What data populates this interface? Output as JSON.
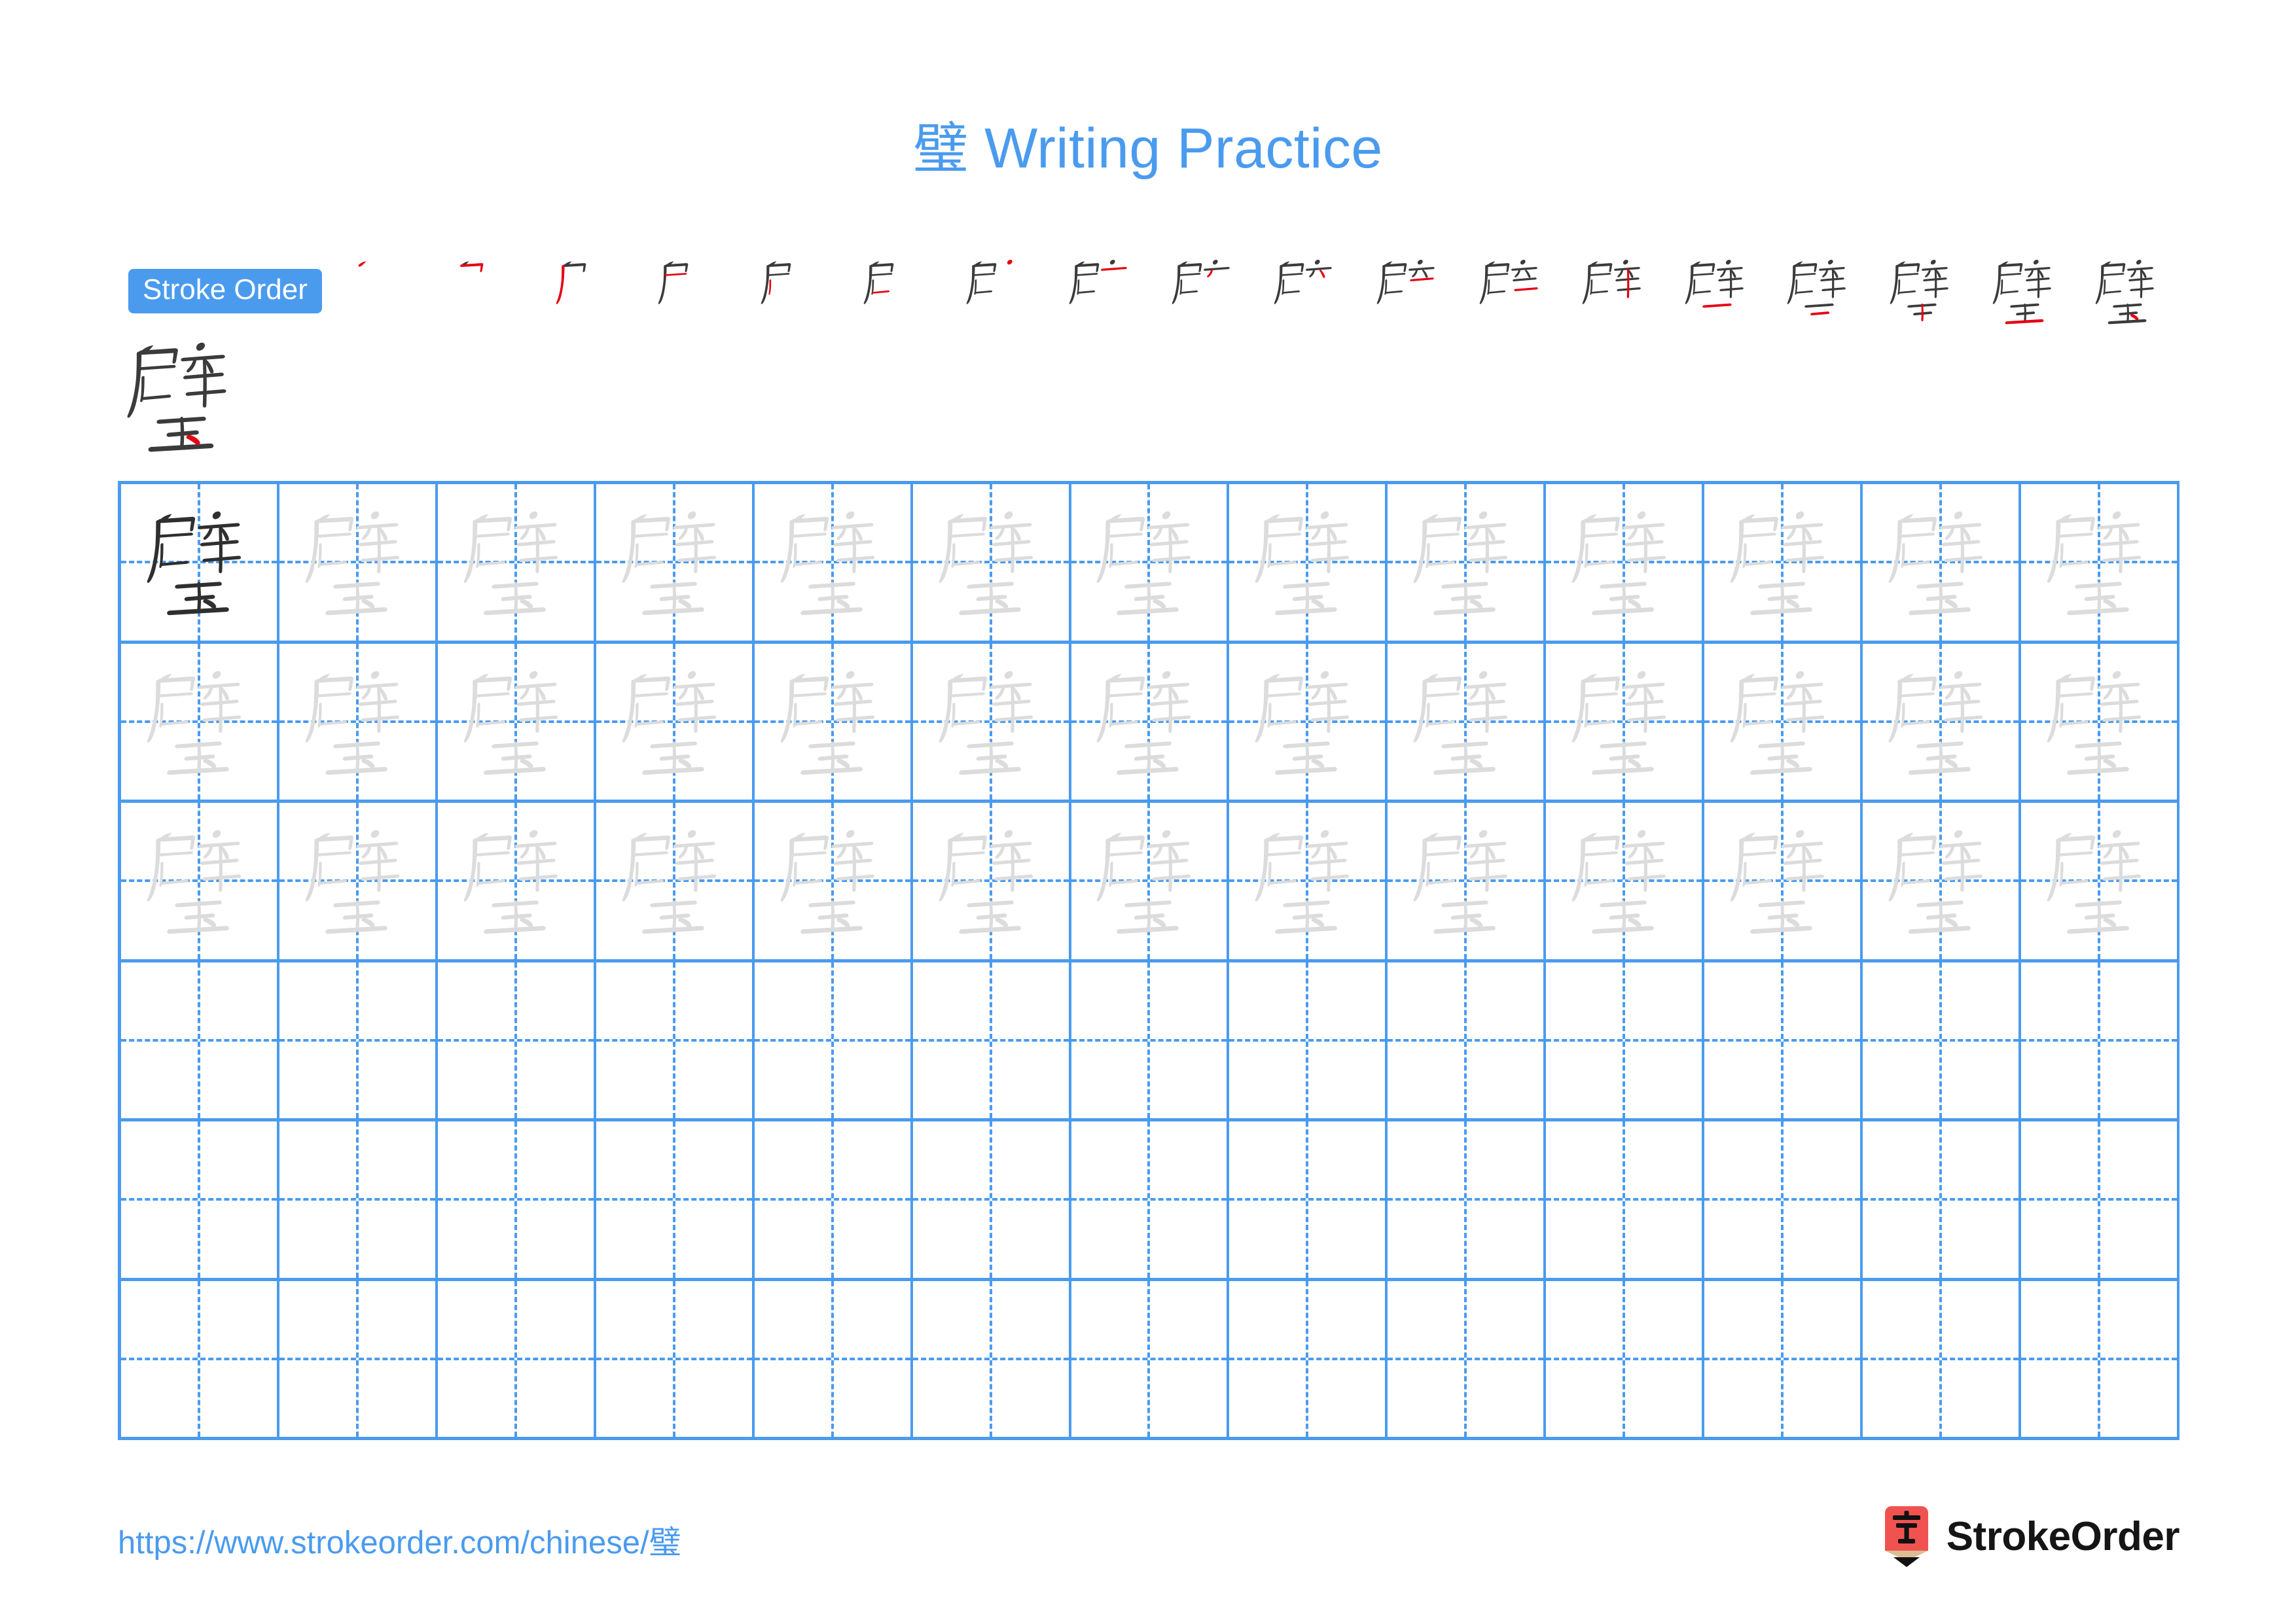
{
  "page": {
    "character": "璧",
    "title": "璧 Writing Practice",
    "title_prefix": "璧",
    "title_suffix": " Writing Practice",
    "accent_color": "#4A9BEE",
    "stroke_highlight_color": "#E60012",
    "stroke_ink_color": "#3B3B3B",
    "trace_color": "#DCDCDC"
  },
  "stroke_order": {
    "label": "Stroke Order",
    "total_strokes": 18,
    "strokes": [
      {
        "index": 1,
        "name": "heng-pie",
        "new_stroke": "㇀"
      },
      {
        "index": 2,
        "name": "heng-zhe",
        "new_stroke": "乛"
      },
      {
        "index": 3,
        "name": "shu-pie",
        "new_stroke": "丿"
      },
      {
        "index": 4,
        "name": "heng",
        "new_stroke": "一"
      },
      {
        "index": 5,
        "name": "shu",
        "new_stroke": "丨"
      },
      {
        "index": 6,
        "name": "heng-bottom",
        "new_stroke": "一"
      },
      {
        "index": 7,
        "name": "dian",
        "new_stroke": "丶"
      },
      {
        "index": 8,
        "name": "heng-top-xin",
        "new_stroke": "一"
      },
      {
        "index": 9,
        "name": "pie",
        "new_stroke": "丿"
      },
      {
        "index": 10,
        "name": "shu-pie-2",
        "new_stroke": "丿"
      },
      {
        "index": 11,
        "name": "heng-2",
        "new_stroke": "一"
      },
      {
        "index": 12,
        "name": "heng-3",
        "new_stroke": "一"
      },
      {
        "index": 13,
        "name": "shu-stem",
        "new_stroke": "丨"
      },
      {
        "index": 14,
        "name": "heng-yu-top",
        "new_stroke": "一"
      },
      {
        "index": 15,
        "name": "heng-yu-mid",
        "new_stroke": "一"
      },
      {
        "index": 16,
        "name": "shu-yu",
        "new_stroke": "丨"
      },
      {
        "index": 17,
        "name": "heng-yu-bottom",
        "new_stroke": "一"
      },
      {
        "index": 18,
        "name": "dian-yu",
        "new_stroke": "丶"
      }
    ]
  },
  "practice_grid": {
    "columns": 13,
    "rows": 6,
    "filled_rows": 3,
    "empty_rows": 3,
    "first_cell_style": "solid-dark",
    "trace_cell_style": "light-gray",
    "guide_lines": "dashed-cross"
  },
  "footer": {
    "url": "https://www.strokeorder.com/chinese/璧",
    "url_text": "https://www.strokeorder.com/chinese/",
    "url_char": "璧",
    "brand_name": "StrokeOrder",
    "brand_mark_char": "字",
    "brand_mark_color": "#F0534F",
    "brand_mark_wood_color": "#DEBC93"
  }
}
